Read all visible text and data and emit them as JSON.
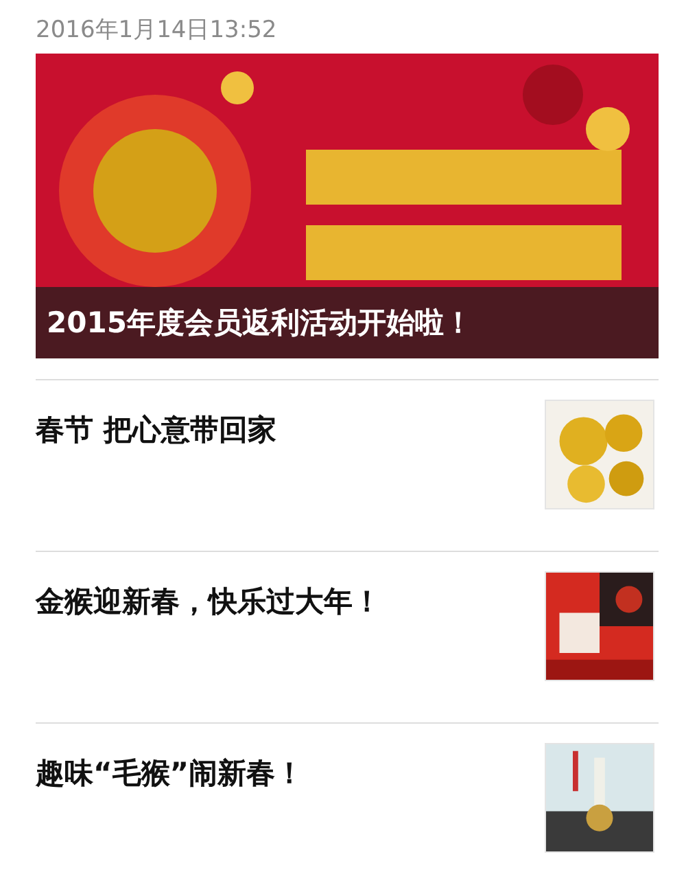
{
  "timestamp": "2016年1月14日13:52",
  "cover": {
    "title": "2015年度会员返利活动开始啦！"
  },
  "articles": [
    {
      "title": "春节 把心意带回家"
    },
    {
      "title": "金猴迎新春，快乐过大年！"
    },
    {
      "title": "趣味“毛猴”闹新春！"
    }
  ]
}
